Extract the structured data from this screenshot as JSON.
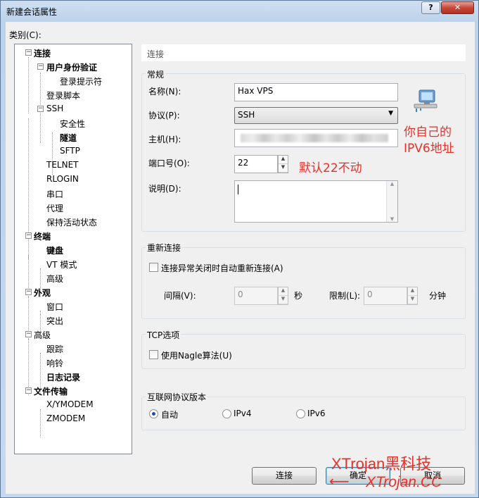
{
  "window": {
    "title": "新建会话属性",
    "help_label": "?",
    "close_label": "✕"
  },
  "category_label": "类别(C):",
  "tree": [
    {
      "label": "连接",
      "bold": true
    },
    {
      "label": "用户身份验证",
      "bold": true
    },
    {
      "label": "登录提示符",
      "bold": false
    },
    {
      "label": "登录脚本",
      "bold": false
    },
    {
      "label": "SSH",
      "bold": false
    },
    {
      "label": "安全性",
      "bold": false
    },
    {
      "label": "隧道",
      "bold": true
    },
    {
      "label": "SFTP",
      "bold": false
    },
    {
      "label": "TELNET",
      "bold": false
    },
    {
      "label": "RLOGIN",
      "bold": false
    },
    {
      "label": "串口",
      "bold": false
    },
    {
      "label": "代理",
      "bold": false
    },
    {
      "label": "保持活动状态",
      "bold": false
    },
    {
      "label": "终端",
      "bold": true
    },
    {
      "label": "键盘",
      "bold": true
    },
    {
      "label": "VT 模式",
      "bold": false
    },
    {
      "label": "高级",
      "bold": false
    },
    {
      "label": "外观",
      "bold": true
    },
    {
      "label": "窗口",
      "bold": false
    },
    {
      "label": "突出",
      "bold": false
    },
    {
      "label": "高级",
      "bold": false
    },
    {
      "label": "跟踪",
      "bold": false
    },
    {
      "label": "响铃",
      "bold": false
    },
    {
      "label": "日志记录",
      "bold": true
    },
    {
      "label": "文件传输",
      "bold": true
    },
    {
      "label": "X/YMODEM",
      "bold": false
    },
    {
      "label": "ZMODEM",
      "bold": false
    }
  ],
  "panel_header": "连接",
  "general": {
    "title": "常规",
    "name_label": "名称(N):",
    "name_value": "Hax VPS",
    "protocol_label": "协议(P):",
    "protocol_value": "SSH",
    "host_label": "主机(H):",
    "port_label": "端口号(O):",
    "port_value": "22",
    "desc_label": "说明(D):"
  },
  "annotations": {
    "host_note_line1": "你自己的",
    "host_note_line2": "IPV6地址",
    "port_note": "默认22不动"
  },
  "reconnect": {
    "title": "重新连接",
    "auto_label": "连接异常关闭时自动重新连接(A)",
    "interval_label": "间隔(V):",
    "interval_value": "0",
    "interval_unit": "秒",
    "limit_label": "限制(L):",
    "limit_value": "0",
    "limit_unit": "分钟"
  },
  "tcp": {
    "title": "TCP选项",
    "nagle_label": "使用Nagle算法(U)"
  },
  "ipver": {
    "title": "互联网协议版本",
    "options": [
      "自动",
      "IPv4",
      "IPv6"
    ],
    "selected": "自动"
  },
  "buttons": {
    "connect": "连接",
    "ok": "确定",
    "cancel": "取消"
  },
  "watermark": {
    "line1": "XTrojan黑科技",
    "line2": "XTrojan.CC",
    "arrow": "⟵"
  }
}
